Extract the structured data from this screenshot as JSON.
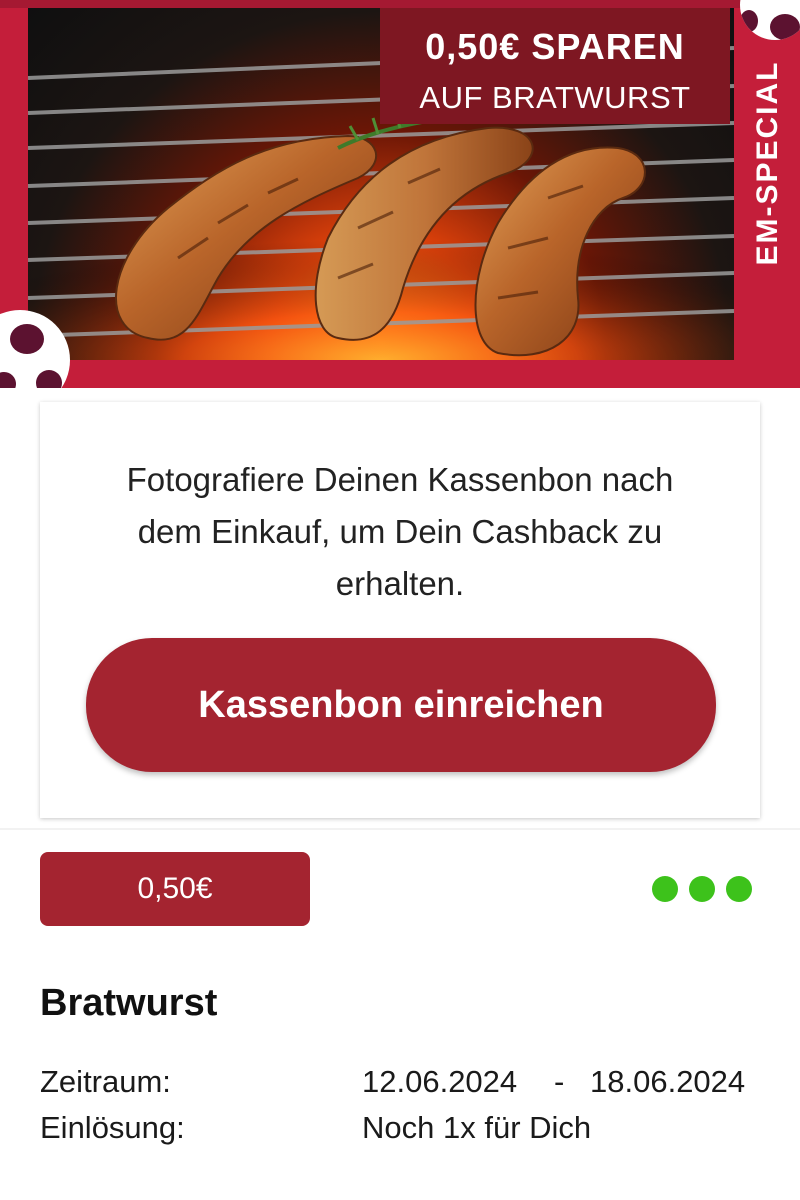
{
  "promo": {
    "headline": "0,50€ SPAREN",
    "subline": "AUF BRATWURST",
    "side_label": "EM-SPECIAL",
    "colors": {
      "banner_red": "#c41e3a",
      "promo_box": "#7e1722",
      "accent_red": "#a42430",
      "status_green": "#3dc21b"
    }
  },
  "card": {
    "instruction": "Fotografiere Deinen Kassenbon nach dem Einkauf, um Dein Cashback zu erhalten.",
    "button_label": "Kassenbon einreichen"
  },
  "offer": {
    "price_badge": "0,50€",
    "more_icon": "more-dots-icon",
    "product_name": "Bratwurst",
    "period_label": "Zeitraum:",
    "period_start": "12.06.2024",
    "period_separator": "-",
    "period_end": "18.06.2024",
    "redeem_label": "Einlösung:",
    "redeem_value": "Noch 1x für Dich"
  }
}
